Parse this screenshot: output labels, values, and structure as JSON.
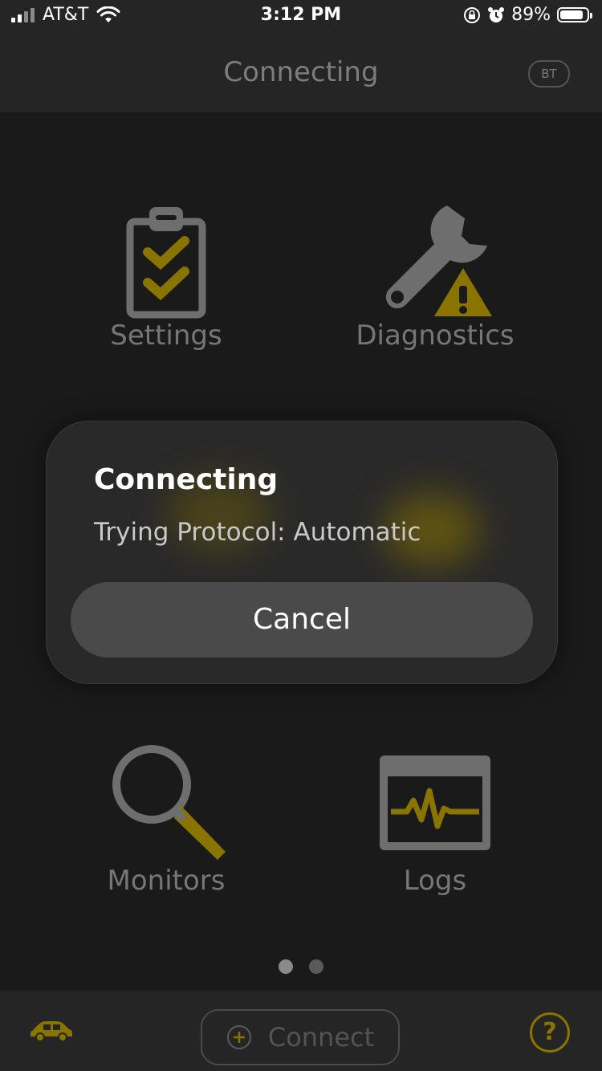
{
  "status_bar": {
    "carrier": "AT&T",
    "time": "3:12 PM",
    "battery_percent": "89%",
    "battery_level": 0.89,
    "icons": [
      "signal-icon",
      "wifi-icon",
      "orientation-lock-icon",
      "alarm-icon",
      "battery-icon"
    ]
  },
  "nav": {
    "title": "Connecting",
    "bt_badge": "BT"
  },
  "tiles": {
    "settings": {
      "label": "Settings",
      "icon": "clipboard-checklist-icon"
    },
    "diagnostics": {
      "label": "Diagnostics",
      "icon": "wrench-warning-icon"
    },
    "monitors": {
      "label": "Monitors",
      "icon": "magnifier-icon"
    },
    "logs": {
      "label": "Logs",
      "icon": "waveform-monitor-icon"
    }
  },
  "dialog": {
    "title": "Connecting",
    "message": "Trying Protocol: Automatic",
    "cancel_label": "Cancel"
  },
  "pager": {
    "pages": 2,
    "active": 1
  },
  "bottom_bar": {
    "connect_label": "Connect",
    "help_symbol": "?",
    "icons": [
      "car-icon",
      "plus-circle-icon",
      "help-icon"
    ]
  },
  "colors": {
    "accent": "#8a7400",
    "icon_gray": "#6e6e6e",
    "background": "#1a1a1a",
    "bar_background": "#252525"
  }
}
